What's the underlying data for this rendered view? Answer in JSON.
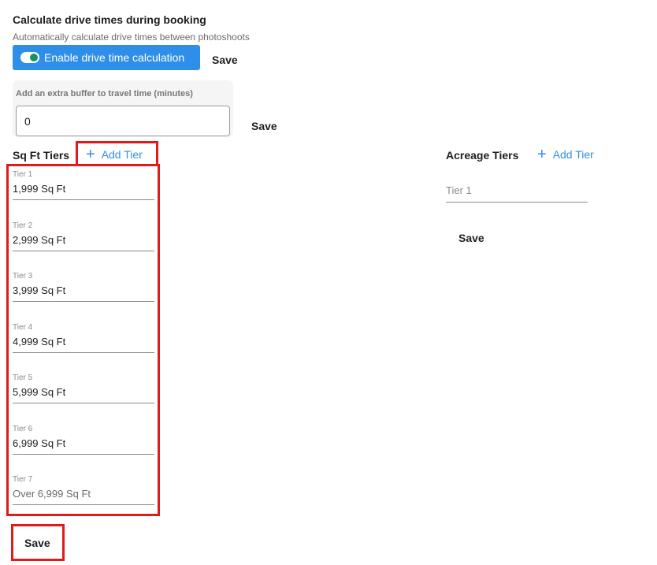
{
  "drive_time": {
    "title": "Calculate drive times during booking",
    "subtitle": "Automatically calculate drive times between photoshoots",
    "toggle_label": "Enable drive time calculation",
    "toggle_on": true,
    "save_label": "Save"
  },
  "buffer": {
    "label": "Add an extra buffer to travel time (minutes)",
    "value": "0",
    "save_label": "Save"
  },
  "sqft": {
    "title": "Sq Ft Tiers",
    "add_label": "Add Tier",
    "tiers": [
      {
        "label": "Tier 1",
        "value": "1,999 Sq Ft"
      },
      {
        "label": "Tier 2",
        "value": "2,999 Sq Ft"
      },
      {
        "label": "Tier 3",
        "value": "3,999 Sq Ft"
      },
      {
        "label": "Tier 4",
        "value": "4,999 Sq Ft"
      },
      {
        "label": "Tier 5",
        "value": "5,999 Sq Ft"
      },
      {
        "label": "Tier 6",
        "value": "6,999 Sq Ft"
      },
      {
        "label": "Tier 7",
        "value": "Over 6,999 Sq Ft"
      }
    ],
    "save_label": "Save"
  },
  "acreage": {
    "title": "Acreage Tiers",
    "add_label": "Add Tier",
    "tier_placeholder": "Tier 1",
    "save_label": "Save"
  },
  "colors": {
    "accent": "#2f8fe8",
    "toggle_knob": "#1a8e6b",
    "highlight": "#e11a1a"
  }
}
